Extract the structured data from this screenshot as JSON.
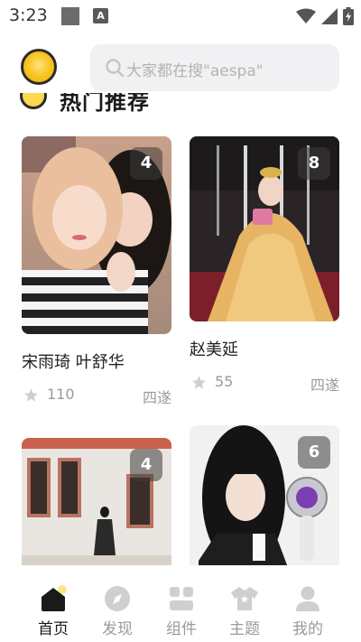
{
  "status_bar": {
    "time": "3:23",
    "notification_icon": "A",
    "icons": [
      "wifi-icon",
      "cell-signal-icon",
      "battery-icon"
    ]
  },
  "header": {
    "search": {
      "placeholder": "大家都在搜\"aespa\""
    }
  },
  "section": {
    "title": "热门推荐"
  },
  "feed": {
    "cards": [
      {
        "title": "宋雨琦 叶舒华",
        "count": "4",
        "likes": "110",
        "author": "四遂"
      },
      {
        "title": "赵美延",
        "count": "8",
        "likes": "55",
        "author": "四遂"
      },
      {
        "title": "",
        "count": "4",
        "likes": "",
        "author": ""
      },
      {
        "title": "",
        "count": "6",
        "likes": "",
        "author": ""
      }
    ]
  },
  "bottom_nav": {
    "items": [
      {
        "label": "首页",
        "icon": "home-icon",
        "active": true
      },
      {
        "label": "发现",
        "icon": "discover-icon",
        "active": false
      },
      {
        "label": "组件",
        "icon": "widgets-icon",
        "active": false
      },
      {
        "label": "主题",
        "icon": "theme-shirt-icon",
        "active": false
      },
      {
        "label": "我的",
        "icon": "profile-icon",
        "active": false
      }
    ]
  },
  "colors": {
    "accent": "#f7c11c",
    "text_primary": "#222222",
    "text_secondary": "#9a9a9a",
    "search_bg": "#f1f1f3",
    "nav_inactive": "#c7c7c7"
  }
}
